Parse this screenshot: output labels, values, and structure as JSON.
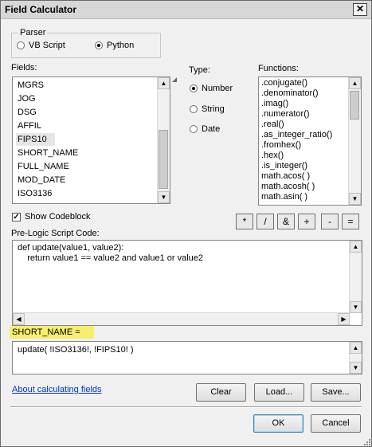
{
  "window": {
    "title": "Field Calculator",
    "close_glyph": "✕"
  },
  "parser": {
    "label": "Parser",
    "options": [
      "VB Script",
      "Python"
    ],
    "selected": "Python"
  },
  "fields": {
    "label": "Fields:",
    "items": [
      "MGRS",
      "JOG",
      "DSG",
      "AFFIL",
      "FIPS10",
      "SHORT_NAME",
      "FULL_NAME",
      "MOD_DATE",
      "ISO3136"
    ],
    "selected": "FIPS10"
  },
  "type": {
    "label": "Type:",
    "options": [
      "Number",
      "String",
      "Date"
    ],
    "selected": "Number"
  },
  "functions": {
    "label": "Functions:",
    "items": [
      ".conjugate()",
      ".denominator()",
      ".imag()",
      ".numerator()",
      ".real()",
      ".as_integer_ratio()",
      ".fromhex()",
      ".hex()",
      ".is_integer()",
      "math.acos( )",
      "math.acosh( )",
      "math.asin( )"
    ]
  },
  "codeblock": {
    "show_label": "Show Codeblock",
    "checked": true,
    "label": "Pre-Logic Script Code:",
    "text": "def update(value1, value2):\n    return value1 == value2 and value1 or value2"
  },
  "operators": [
    "*",
    "/",
    "&",
    "+",
    "-",
    "="
  ],
  "expression": {
    "label": "SHORT_NAME =",
    "text": "update( !ISO3136!, !FIPS10! )"
  },
  "links": {
    "about": "About calculating fields"
  },
  "buttons": {
    "clear": "Clear",
    "load": "Load...",
    "save": "Save...",
    "ok": "OK",
    "cancel": "Cancel"
  },
  "colors": {
    "highlight": "#f6ef6d",
    "link": "#0033cc"
  }
}
